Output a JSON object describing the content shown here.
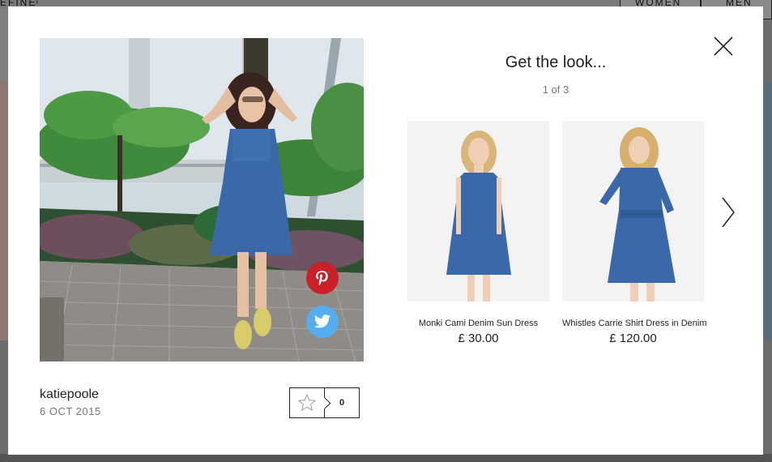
{
  "background": {
    "nav_left_label": "EFINE",
    "nav_women_label": "WOMEN",
    "nav_men_label": "MEN"
  },
  "modal": {
    "close_icon": "close-icon",
    "post": {
      "username": "katiepoole",
      "date": "6 OCT 2015",
      "like_count": "0",
      "share": [
        "pinterest-icon",
        "twitter-icon"
      ]
    },
    "look": {
      "title": "Get the look...",
      "pagination": "1 of 3",
      "products": [
        {
          "name": "Monki Cami Denim Sun Dress",
          "price": "£ 30.00"
        },
        {
          "name": "Whistles Carrie Shirt Dress in Denim",
          "price": "£ 120.00"
        }
      ]
    }
  },
  "colors": {
    "pinterest": "#cb2027",
    "twitter": "#55acee",
    "denim": "#3a68a8"
  }
}
